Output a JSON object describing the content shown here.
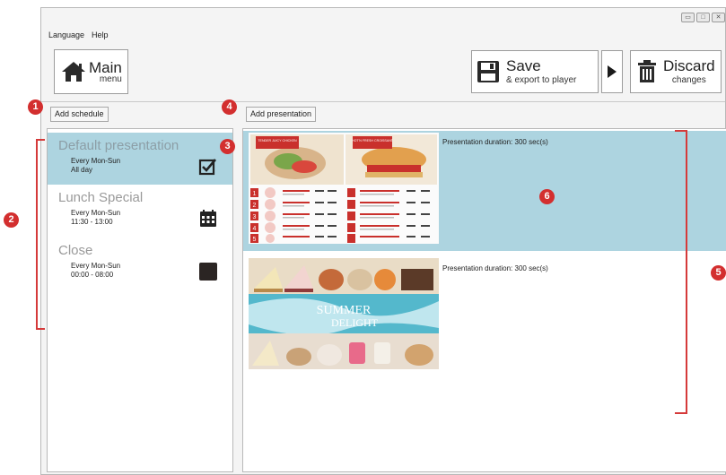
{
  "menu": {
    "language": "Language",
    "help": "Help"
  },
  "toolbar": {
    "main_title": "Main",
    "main_sub": "menu",
    "save_title": "Save",
    "save_sub": "& export to player",
    "discard_title": "Discard",
    "discard_sub": "changes"
  },
  "buttons": {
    "add_schedule": "Add schedule",
    "add_presentation": "Add presentation"
  },
  "schedules": [
    {
      "title": "Default presentation",
      "days": "Every Mon-Sun",
      "time": "All day",
      "icon": "checkbox-checked-icon"
    },
    {
      "title": "Lunch Special",
      "days": "Every Mon-Sun",
      "time": "11:30 - 13:00",
      "icon": "calendar-icon"
    },
    {
      "title": "Close",
      "days": "Every Mon-Sun",
      "time": "00:00 - 08:00",
      "icon": "black-square-icon"
    }
  ],
  "presentations": [
    {
      "duration": "Presentation duration: 300 sec(s)",
      "thumb": {
        "label_1": "TENDER JUICY CHICKEN",
        "label_2": "HOT'N FRESH CROISSANT",
        "numbers": [
          "1",
          "2",
          "3",
          "4",
          "5"
        ]
      }
    },
    {
      "duration": "Presentation duration: 300 sec(s)",
      "thumb": {
        "line_1": "SUMMER",
        "line_2": "DELIGHT"
      }
    }
  ],
  "callouts": [
    "1",
    "2",
    "3",
    "4",
    "5",
    "6"
  ],
  "colors": {
    "selection": "#add4e0",
    "callout": "#d32f2f",
    "thumb_red": "#c9302c"
  }
}
